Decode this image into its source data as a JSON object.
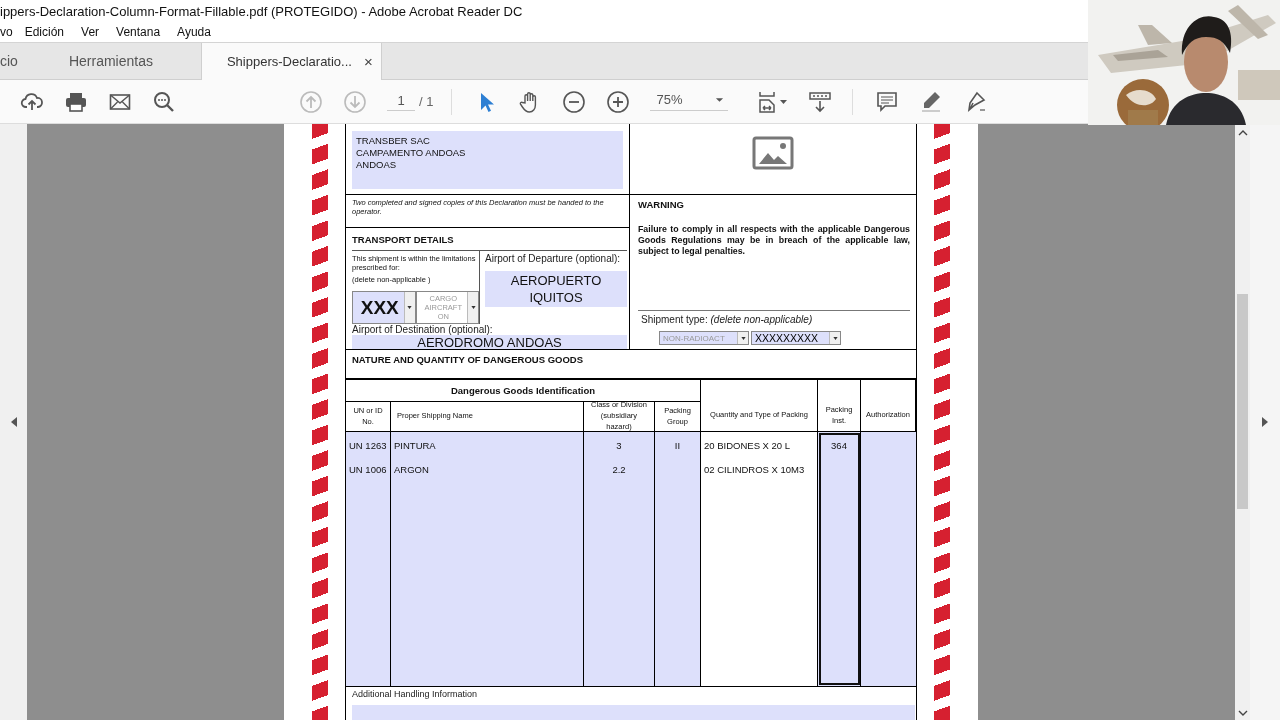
{
  "window": {
    "title": "ippers-Declaration-Column-Format-Fillable.pdf (PROTEGIDO) - Adobe Acrobat Reader DC"
  },
  "menu": [
    "vo",
    "Edición",
    "Ver",
    "Ventana",
    "Ayuda"
  ],
  "tabs": [
    {
      "label": "cio",
      "selected": false
    },
    {
      "label": "Herramientas",
      "selected": false
    },
    {
      "label": "Shippers-Declaratio...",
      "selected": true,
      "close": "×"
    }
  ],
  "toolbar": {
    "page": "1",
    "page_total": "/ 1",
    "zoom": "75%"
  },
  "form": {
    "consignee_lines": [
      "TRANSBER SAC",
      "CAMPAMENTO ANDOAS",
      "ANDOAS"
    ],
    "copies_note": "Two completed and signed copies of this Declaration must be handed to the operator.",
    "transport_title": "TRANSPORT DETAILS",
    "limitations_text": "This shipment is within the limitations prescribed for:",
    "delete_note": "(delete non-applicable )",
    "aircraft_dropdowns": [
      {
        "value": "XXX",
        "active": true
      },
      {
        "value": "CARGO AIRCRAFT ON",
        "active": false
      }
    ],
    "departure_label": "Airport of Departure (optional):",
    "departure_value": "AEROPUERTO IQUITOS",
    "destination_label": "Airport of Destination (optional):",
    "destination_value": "AERODROMO ANDOAS",
    "warning_title": "WARNING",
    "warning_text": "Failure to comply in all respects with the applicable Dangerous Goods Regulations may be in breach of the applicable law, subject to legal penalties.",
    "shipment_type_label": "Shipment type: *(delete non-applicable)*",
    "shipment_dropdowns": [
      {
        "value": "NON-RADIOACT",
        "active": false
      },
      {
        "value": "XXXXXXXXX",
        "active": true
      }
    ],
    "nature_title": "NATURE AND QUANTITY OF DANGEROUS GOODS",
    "identification_title": "Dangerous Goods Identification",
    "columns": [
      {
        "label": "UN or ID No.",
        "fillable": true,
        "focused": false
      },
      {
        "label": "Proper Shipping Name",
        "fillable": true,
        "focused": false
      },
      {
        "label": "Class or Division (subsidiary hazard)",
        "fillable": true,
        "focused": false
      },
      {
        "label": "Packing Group",
        "fillable": true,
        "focused": false
      },
      {
        "label": "Quantity and Type of Packing",
        "fillable": false,
        "focused": false
      },
      {
        "label": "Packing Inst.",
        "fillable": true,
        "focused": true
      },
      {
        "label": "Authorization",
        "fillable": true,
        "focused": false
      }
    ],
    "rows": [
      {
        "cells": [
          "UN 1263",
          "PINTURA",
          "3",
          "II",
          "20 BIDONES X 20 L",
          "364",
          null
        ]
      },
      {
        "cells": [
          "UN 1006",
          "ARGON",
          "2.2",
          null,
          "02 CILINDROS X 10M3",
          null,
          null
        ]
      }
    ],
    "handling_label": "Additional Handling Information"
  }
}
